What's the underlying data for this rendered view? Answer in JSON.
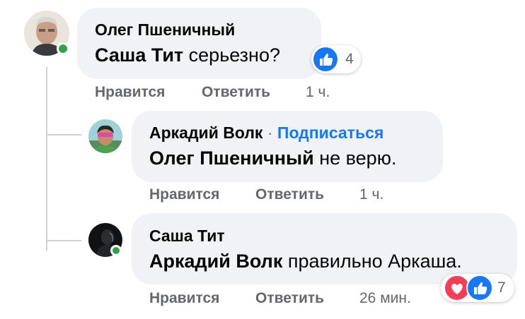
{
  "comments": [
    {
      "author": "Олег Пшеничный",
      "mention": "Саша Тит",
      "text": " серьезно?",
      "like_label": "Нравится",
      "reply_label": "Ответить",
      "time": "1 ч.",
      "reaction_count": "4",
      "reactions": [
        "like-icon"
      ]
    },
    {
      "author": "Аркадий Волк",
      "separator": "·",
      "follow_label": "Подписаться",
      "mention": "Олег Пшеничный",
      "text": " не верю.",
      "like_label": "Нравится",
      "reply_label": "Ответить",
      "time": "1 ч."
    },
    {
      "author": "Саша Тит",
      "mention": "Аркадий Волк",
      "text": " правильно Аркаша.",
      "like_label": "Нравится",
      "reply_label": "Ответить",
      "time": "26 мин.",
      "reaction_count": "7",
      "reactions": [
        "love-icon",
        "like-icon"
      ]
    }
  ],
  "colors": {
    "bubble": "#f0f2f5",
    "like_blue": "#1877f2",
    "love_red": "#f33e58",
    "online_green": "#31a24c",
    "meta_gray": "#65676b"
  }
}
